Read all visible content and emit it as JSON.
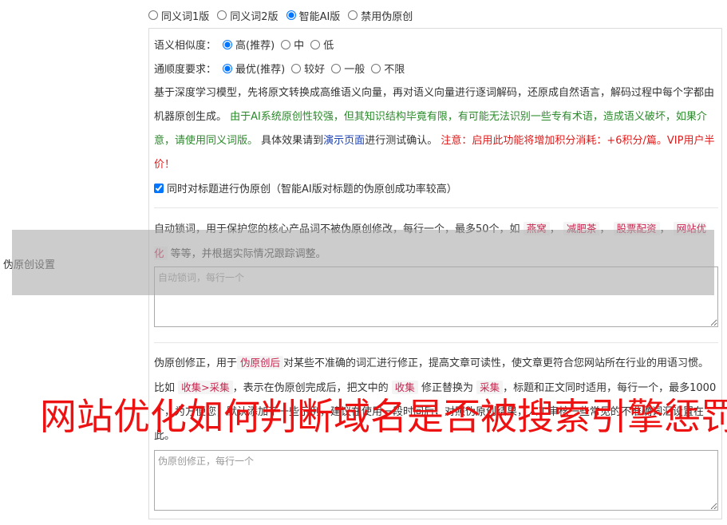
{
  "mode": {
    "options": [
      "同义词1版",
      "同义词2版",
      "智能AI版",
      "禁用伪原创"
    ],
    "selected": 2
  },
  "side_label": "伪原创设置",
  "similarity": {
    "label": "语义相似度：",
    "options": [
      "高(推荐)",
      "中",
      "低"
    ],
    "selected": 0
  },
  "fluency": {
    "label": "通顺度要求：",
    "options": [
      "最优(推荐)",
      "较好",
      "一般",
      "不限"
    ],
    "selected": 0
  },
  "description": {
    "part1": "基于深度学习模型，先将原文转换成高维语义向量，再对语义向量进行逐词解码，还原成自然语言，解码过程中每个字都由机器原创生成。",
    "part2_green": "由于AI系统原创性较强，但其知识结构毕竟有限，有可能无法识别一些专有术语，造成语义破坏，如果介意，请使用同义词版。",
    "part3": "具体效果请到",
    "link": "演示页面",
    "part4": "进行测试确认。",
    "part5_red": "注意：启用此功能将增加积分消耗：+6积分/篇。VIP用户半价！"
  },
  "title_checkbox": {
    "label": "同时对标题进行伪原创（智能AI版对标题的伪原创成功率较高）",
    "checked": true
  },
  "lock_words": {
    "text_before": "自动锁词，用于保护您的核心产品词不被伪原创修改，每行一个，最多50个，如",
    "tags": [
      "燕窝",
      "减肥茶",
      "股票配资",
      "网站优化"
    ],
    "text_after": "等等，并根据实际情况跟踪调整。",
    "placeholder": "自动锁词，每行一个"
  },
  "correction": {
    "text1": "伪原创修正，用于",
    "tag1": "伪原创后",
    "text2": "对某些不准确的词汇进行修正，提高文章可读性，使文章更符合您网站所在行业的用语习惯。比如",
    "tag2": "收集>采集",
    "text3": "，表示在伪原创完成后，把文中的",
    "tag3": "收集",
    "text4": "修正替换为",
    "tag4": "采集",
    "text5": "，标题和正文同时适用，每行一个，最多1000个，为方便您，默认添加了一些示例，建议在使用一段时间后，对照伪原创结果，人工审核一些常见的不准确词汇设置在此。",
    "placeholder": "伪原创修正，每行一个"
  },
  "overlay_title": "网站优化如何判断域名是否被搜索引擎惩罚"
}
